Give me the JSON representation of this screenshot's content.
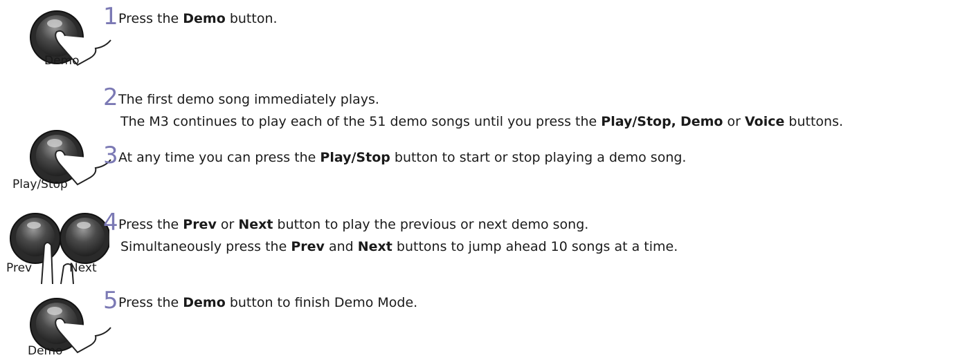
{
  "accent_color": "#7b79b4",
  "steps": [
    {
      "number": "1",
      "lines": [
        [
          {
            "t": "Press the "
          },
          {
            "t": "Demo",
            "b": true
          },
          {
            "t": " button."
          }
        ]
      ]
    },
    {
      "number": "2",
      "lines": [
        [
          {
            "t": "The first demo song immediately plays."
          }
        ],
        [
          {
            "t": "The M3 continues to play each of the 51 demo songs until you press the "
          },
          {
            "t": "Play/Stop,",
            "b": true
          },
          {
            "t": " "
          },
          {
            "t": "Demo",
            "b": true
          },
          {
            "t": " or "
          },
          {
            "t": "Voice",
            "b": true
          },
          {
            "t": " buttons."
          }
        ]
      ]
    },
    {
      "number": "3",
      "lines": [
        [
          {
            "t": "At any time you can press the "
          },
          {
            "t": "Play/Stop",
            "b": true
          },
          {
            "t": " button to start or stop playing a demo song."
          }
        ]
      ]
    },
    {
      "number": "4",
      "lines": [
        [
          {
            "t": "Press the "
          },
          {
            "t": "Prev",
            "b": true
          },
          {
            "t": " or "
          },
          {
            "t": "Next",
            "b": true
          },
          {
            "t": " button to play the previous or next demo song."
          }
        ],
        [
          {
            "t": "Simultaneously press the "
          },
          {
            "t": "Prev",
            "b": true
          },
          {
            "t": " and "
          },
          {
            "t": "Next",
            "b": true
          },
          {
            "t": " buttons to jump ahead 10 songs at a time."
          }
        ]
      ]
    },
    {
      "number": "5",
      "lines": [
        [
          {
            "t": "Press the "
          },
          {
            "t": "Demo",
            "b": true
          },
          {
            "t": " button to finish Demo Mode."
          }
        ]
      ]
    }
  ],
  "figures": {
    "demo_1": "Demo",
    "play_stop": "Play/Stop",
    "prev": "Prev",
    "next": "Next",
    "demo_5": "Demo"
  },
  "icons": [
    "round-button-icon",
    "pressing-finger-icon"
  ]
}
